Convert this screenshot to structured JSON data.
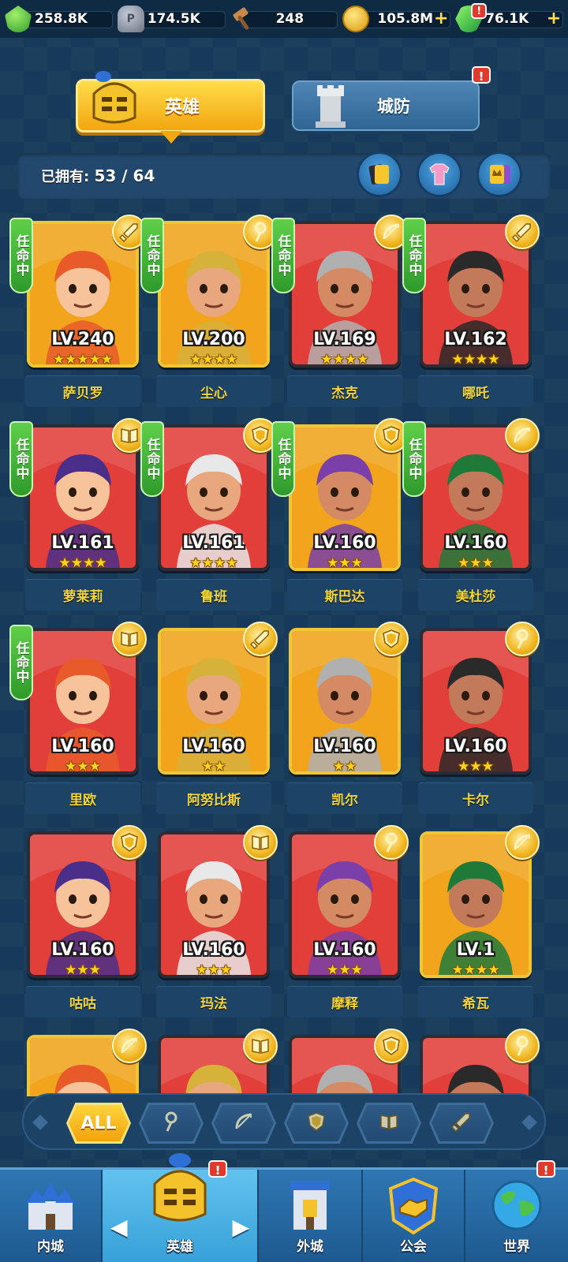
{
  "resources": [
    {
      "icon": "green-crystal-icon",
      "value": "258.8K",
      "plus": false
    },
    {
      "icon": "stone-icon",
      "value": "174.5K",
      "plus": false
    },
    {
      "icon": "hammer-icon",
      "value": "248",
      "plus": false
    },
    {
      "icon": "gold-coin-icon",
      "value": "105.8M",
      "plus": true
    },
    {
      "icon": "emerald-gem-icon",
      "value": "76.1K",
      "plus": true
    }
  ],
  "tabs": {
    "hero": "英雄",
    "defense": "城防",
    "alert": "!"
  },
  "owned": {
    "label": "已拥有:",
    "count": "53 / 64"
  },
  "appoint_label": "任命中",
  "heroes": [
    {
      "name": "萨贝罗",
      "level": "LV.240",
      "stars": "★★★★★",
      "cls": "sword",
      "appointed": true,
      "bg": "#f1a41c",
      "gold": true
    },
    {
      "name": "尘心",
      "level": "LV.200",
      "stars": "★★★★",
      "cls": "staff",
      "appointed": true,
      "bg": "#f1a41c",
      "gold": true
    },
    {
      "name": "杰克",
      "level": "LV.169",
      "stars": "★★★★",
      "cls": "bow",
      "appointed": true,
      "bg": "#e23e3a",
      "gold": false
    },
    {
      "name": "哪吒",
      "level": "LV.162",
      "stars": "★★★★",
      "cls": "sword",
      "appointed": true,
      "bg": "#e23e3a",
      "gold": false
    },
    {
      "name": "萝莱莉",
      "level": "LV.161",
      "stars": "★★★★",
      "cls": "book",
      "appointed": true,
      "bg": "#e23e3a",
      "gold": false
    },
    {
      "name": "鲁班",
      "level": "LV.161",
      "stars": "★★★★",
      "cls": "shield",
      "appointed": true,
      "bg": "#e23e3a",
      "gold": false
    },
    {
      "name": "斯巴达",
      "level": "LV.160",
      "stars": "★★★",
      "cls": "shield",
      "appointed": true,
      "bg": "#f1a41c",
      "gold": true
    },
    {
      "name": "美杜莎",
      "level": "LV.160",
      "stars": "★★★",
      "cls": "bow",
      "appointed": true,
      "bg": "#e23e3a",
      "gold": false
    },
    {
      "name": "里欧",
      "level": "LV.160",
      "stars": "★★★",
      "cls": "book",
      "appointed": true,
      "bg": "#e23e3a",
      "gold": false
    },
    {
      "name": "阿努比斯",
      "level": "LV.160",
      "stars": "★★",
      "cls": "sword",
      "appointed": false,
      "bg": "#f1a41c",
      "gold": true
    },
    {
      "name": "凯尔",
      "level": "LV.160",
      "stars": "★★",
      "cls": "shield",
      "appointed": false,
      "bg": "#f1a41c",
      "gold": true
    },
    {
      "name": "卡尔",
      "level": "LV.160",
      "stars": "★★★",
      "cls": "staff",
      "appointed": false,
      "bg": "#e23e3a",
      "gold": false
    },
    {
      "name": "咕咕",
      "level": "LV.160",
      "stars": "★★★",
      "cls": "shield",
      "appointed": false,
      "bg": "#e23e3a",
      "gold": false
    },
    {
      "name": "玛法",
      "level": "LV.160",
      "stars": "★★★",
      "cls": "book",
      "appointed": false,
      "bg": "#e23e3a",
      "gold": false
    },
    {
      "name": "摩释",
      "level": "LV.160",
      "stars": "★★★",
      "cls": "staff",
      "appointed": false,
      "bg": "#e23e3a",
      "gold": false
    },
    {
      "name": "希瓦",
      "level": "LV.1",
      "stars": "★★★★",
      "cls": "bow",
      "appointed": false,
      "bg": "#f1a41c",
      "gold": true
    },
    {
      "name": "",
      "level": "",
      "stars": "",
      "cls": "bow",
      "appointed": false,
      "bg": "#f1a41c",
      "gold": true
    },
    {
      "name": "",
      "level": "",
      "stars": "",
      "cls": "book",
      "appointed": false,
      "bg": "#e23e3a",
      "gold": false
    },
    {
      "name": "",
      "level": "",
      "stars": "",
      "cls": "shield",
      "appointed": false,
      "bg": "#e23e3a",
      "gold": false
    },
    {
      "name": "",
      "level": "",
      "stars": "",
      "cls": "staff",
      "appointed": false,
      "bg": "#e23e3a",
      "gold": false
    }
  ],
  "filters": [
    {
      "label": "ALL",
      "icon": "",
      "active": true
    },
    {
      "label": "",
      "icon": "staff-class-icon",
      "active": false
    },
    {
      "label": "",
      "icon": "bow-class-icon",
      "active": false
    },
    {
      "label": "",
      "icon": "shield-class-icon",
      "active": false
    },
    {
      "label": "",
      "icon": "book-class-icon",
      "active": false
    },
    {
      "label": "",
      "icon": "sword-class-icon",
      "active": false
    }
  ],
  "nav": [
    {
      "label": "内城",
      "icon": "inner-city-castle-icon",
      "active": false,
      "alert": false
    },
    {
      "label": "英雄",
      "icon": "hero-helmet-icon",
      "active": true,
      "alert": true
    },
    {
      "label": "外城",
      "icon": "outer-city-tower-icon",
      "active": false,
      "alert": false
    },
    {
      "label": "公会",
      "icon": "guild-handshake-icon",
      "active": false,
      "alert": false
    },
    {
      "label": "世界",
      "icon": "world-globe-icon",
      "active": false,
      "alert": true
    }
  ]
}
